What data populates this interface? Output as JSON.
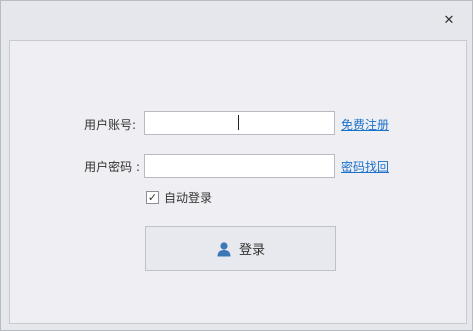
{
  "window": {
    "close_glyph": "✕"
  },
  "form": {
    "username_label": "用户账号:",
    "username_value": "",
    "password_label": "用户密码 :",
    "password_value": "",
    "register_link": "免费注册",
    "recover_link": "密码找回",
    "remember_label": "自动登录",
    "remember_checked": true,
    "login_button": "登录"
  },
  "icons": {
    "close": "close-icon",
    "user": "user-icon",
    "check": "checkmark-icon"
  },
  "colors": {
    "link": "#1a72c9",
    "user_icon": "#3b77b8"
  }
}
